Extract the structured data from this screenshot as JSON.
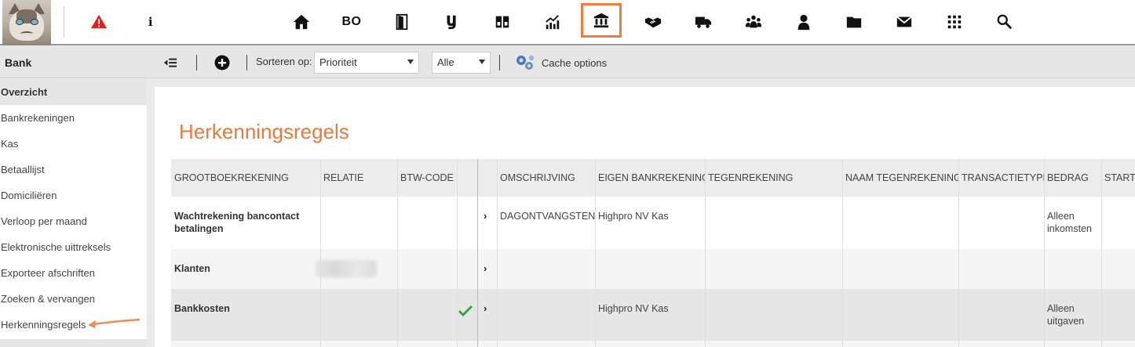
{
  "nav": {
    "bo_label": "BO",
    "info_label": "i",
    "alert_color": "#e02020",
    "active_accent": "#f07b3c",
    "icons": [
      "warning-icon",
      "info-icon",
      "home-icon",
      "bo-icon",
      "door-icon",
      "y-icon",
      "grid-small-icon",
      "chart-icon",
      "bank-icon",
      "handshake-icon",
      "truck-icon",
      "group-icon",
      "user-icon",
      "folder-icon",
      "mail-icon",
      "apps-icon",
      "search-icon"
    ]
  },
  "toolbar": {
    "section_title": "Bank",
    "sort_label": "Sorteren op:",
    "sort_value": "Prioriteit",
    "filter_value": "Alle",
    "cache_label": "Cache options"
  },
  "sidebar": {
    "items": [
      {
        "label": "Overzicht",
        "active": true
      },
      {
        "label": "Bankrekeningen"
      },
      {
        "label": "Kas"
      },
      {
        "label": "Betaallijst"
      },
      {
        "label": "Domiciliëren"
      },
      {
        "label": "Verloop per maand"
      },
      {
        "label": "Elektronische uittreksels"
      },
      {
        "label": "Exporteer afschriften"
      },
      {
        "label": "Zoeken & vervangen"
      },
      {
        "label": "Herkenningsregels"
      }
    ]
  },
  "main": {
    "title": "Herkenningsregels",
    "title_color": "#e77a3c",
    "columns": [
      "GROOTBOEKREKENING",
      "RELATIE",
      "BTW-CODE",
      "",
      "",
      "OMSCHRIJVING",
      "EIGEN BANKREKENING",
      "TEGENREKENING",
      "NAAM TEGENREKENING",
      "TRANSACTIETYPE",
      "BEDRAG",
      "START-"
    ],
    "rows": [
      {
        "account": "Wachtrekening bancontact betalingen",
        "description": "DAGONTVANGSTEN",
        "own_account": "Highpro NV Kas",
        "amount": "Alleen inkomsten",
        "checked": false
      },
      {
        "account": "Klanten",
        "description": "",
        "own_account": "",
        "amount": "",
        "checked": false
      },
      {
        "account": "Bankkosten",
        "description": "",
        "own_account": "Highpro NV Kas",
        "amount": "Alleen uitgaven",
        "checked": true
      }
    ]
  }
}
